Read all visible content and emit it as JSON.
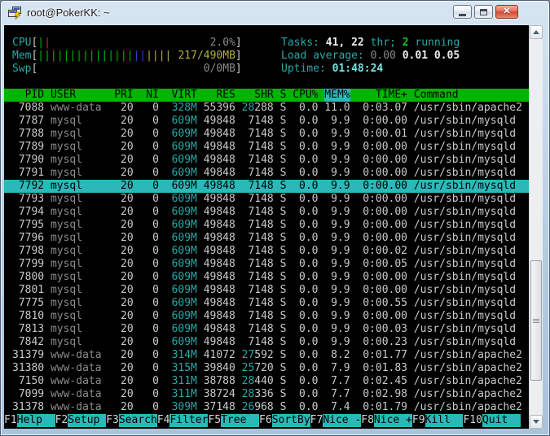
{
  "window": {
    "title": "root@PokerKK: ~"
  },
  "colors": {
    "header_green": "#00b400",
    "accent_cyan": "#2bb8b8",
    "teal_text": "#2aa8a8",
    "meter_green": "#00b400",
    "meter_red": "#c03030",
    "meter_blue": "#3a3ad0",
    "meter_yellow": "#b0b038",
    "terminal_bg": "#000000"
  },
  "meters": [
    {
      "name": "cpu",
      "label": "CPU",
      "value": "2.0%",
      "value_color": "#8a8a8a",
      "ticks": [
        {
          "color": "#00b400",
          "count": 1
        },
        {
          "color": "#c03030",
          "count": 1
        }
      ]
    },
    {
      "name": "mem",
      "label": "Mem",
      "value": "217/490MB",
      "value_color": "#b0b038",
      "ticks": [
        {
          "color": "#00b400",
          "count": 15
        },
        {
          "color": "#3a3ad0",
          "count": 2
        },
        {
          "color": "#b0b038",
          "count": 4
        }
      ]
    },
    {
      "name": "swp",
      "label": "Swp",
      "value": "0/0MB",
      "value_color": "#8a8a8a",
      "ticks": []
    }
  ],
  "stats": {
    "tasks": {
      "label": "Tasks: ",
      "count": "41, 22",
      "thr": " thr; ",
      "running_n": "2",
      "running": " running"
    },
    "load": {
      "label": "Load average: ",
      "v1": "0.00",
      "v2": " 0.01",
      "v3": " 0.05"
    },
    "uptime": {
      "label": "Uptime: ",
      "value": "01:48:24"
    }
  },
  "table": {
    "columns": {
      "pid": "PID",
      "user": "USER",
      "pri": "PRI",
      "ni": "NI",
      "virt": "VIRT",
      "res": "RES",
      "shr": "SHR",
      "s": "S",
      "cpu": "CPU%",
      "mem": "MEM%",
      "time": "TIME+",
      "cmd": "Command"
    },
    "sort_column": "MEM%",
    "rows": [
      {
        "pid": "7088",
        "user": "www-data",
        "pri": "20",
        "ni": "0",
        "virt": "328M",
        "res": "55396",
        "shr_hi": "28",
        "shr_lo": "288",
        "s": "S",
        "cpu": "0.0",
        "mem": "11.0",
        "time": "0:03.07",
        "cmd": "/usr/sbin/apache2",
        "selected": false
      },
      {
        "pid": "7787",
        "user": "mysql",
        "pri": "20",
        "ni": "0",
        "virt": "609M",
        "res": "49848",
        "shr_hi": "",
        "shr_lo": "7148",
        "s": "S",
        "cpu": "0.0",
        "mem": "9.9",
        "time": "0:00.00",
        "cmd": "/usr/sbin/mysqld",
        "selected": false
      },
      {
        "pid": "7788",
        "user": "mysql",
        "pri": "20",
        "ni": "0",
        "virt": "609M",
        "res": "49848",
        "shr_hi": "",
        "shr_lo": "7148",
        "s": "S",
        "cpu": "0.0",
        "mem": "9.9",
        "time": "0:00.01",
        "cmd": "/usr/sbin/mysqld",
        "selected": false
      },
      {
        "pid": "7789",
        "user": "mysql",
        "pri": "20",
        "ni": "0",
        "virt": "609M",
        "res": "49848",
        "shr_hi": "",
        "shr_lo": "7148",
        "s": "S",
        "cpu": "0.0",
        "mem": "9.9",
        "time": "0:00.00",
        "cmd": "/usr/sbin/mysqld",
        "selected": false
      },
      {
        "pid": "7790",
        "user": "mysql",
        "pri": "20",
        "ni": "0",
        "virt": "609M",
        "res": "49848",
        "shr_hi": "",
        "shr_lo": "7148",
        "s": "S",
        "cpu": "0.0",
        "mem": "9.9",
        "time": "0:00.00",
        "cmd": "/usr/sbin/mysqld",
        "selected": false
      },
      {
        "pid": "7791",
        "user": "mysql",
        "pri": "20",
        "ni": "0",
        "virt": "609M",
        "res": "49848",
        "shr_hi": "",
        "shr_lo": "7148",
        "s": "S",
        "cpu": "0.0",
        "mem": "9.9",
        "time": "0:00.00",
        "cmd": "/usr/sbin/mysqld",
        "selected": false
      },
      {
        "pid": "7792",
        "user": "mysql",
        "pri": "20",
        "ni": "0",
        "virt": "609M",
        "res": "49848",
        "shr_hi": "",
        "shr_lo": "7148",
        "s": "S",
        "cpu": "0.0",
        "mem": "9.9",
        "time": "0:00.00",
        "cmd": "/usr/sbin/mysqld",
        "selected": true
      },
      {
        "pid": "7793",
        "user": "mysql",
        "pri": "20",
        "ni": "0",
        "virt": "609M",
        "res": "49848",
        "shr_hi": "",
        "shr_lo": "7148",
        "s": "S",
        "cpu": "0.0",
        "mem": "9.9",
        "time": "0:00.00",
        "cmd": "/usr/sbin/mysqld",
        "selected": false
      },
      {
        "pid": "7794",
        "user": "mysql",
        "pri": "20",
        "ni": "0",
        "virt": "609M",
        "res": "49848",
        "shr_hi": "",
        "shr_lo": "7148",
        "s": "S",
        "cpu": "0.0",
        "mem": "9.9",
        "time": "0:00.00",
        "cmd": "/usr/sbin/mysqld",
        "selected": false
      },
      {
        "pid": "7795",
        "user": "mysql",
        "pri": "20",
        "ni": "0",
        "virt": "609M",
        "res": "49848",
        "shr_hi": "",
        "shr_lo": "7148",
        "s": "S",
        "cpu": "0.0",
        "mem": "9.9",
        "time": "0:00.00",
        "cmd": "/usr/sbin/mysqld",
        "selected": false
      },
      {
        "pid": "7796",
        "user": "mysql",
        "pri": "20",
        "ni": "0",
        "virt": "609M",
        "res": "49848",
        "shr_hi": "",
        "shr_lo": "7148",
        "s": "S",
        "cpu": "0.0",
        "mem": "9.9",
        "time": "0:00.00",
        "cmd": "/usr/sbin/mysqld",
        "selected": false
      },
      {
        "pid": "7798",
        "user": "mysql",
        "pri": "20",
        "ni": "0",
        "virt": "609M",
        "res": "49848",
        "shr_hi": "",
        "shr_lo": "7148",
        "s": "S",
        "cpu": "0.0",
        "mem": "9.9",
        "time": "0:00.02",
        "cmd": "/usr/sbin/mysqld",
        "selected": false
      },
      {
        "pid": "7799",
        "user": "mysql",
        "pri": "20",
        "ni": "0",
        "virt": "609M",
        "res": "49848",
        "shr_hi": "",
        "shr_lo": "7148",
        "s": "S",
        "cpu": "0.0",
        "mem": "9.9",
        "time": "0:00.05",
        "cmd": "/usr/sbin/mysqld",
        "selected": false
      },
      {
        "pid": "7800",
        "user": "mysql",
        "pri": "20",
        "ni": "0",
        "virt": "609M",
        "res": "49848",
        "shr_hi": "",
        "shr_lo": "7148",
        "s": "S",
        "cpu": "0.0",
        "mem": "9.9",
        "time": "0:00.00",
        "cmd": "/usr/sbin/mysqld",
        "selected": false
      },
      {
        "pid": "7801",
        "user": "mysql",
        "pri": "20",
        "ni": "0",
        "virt": "609M",
        "res": "49848",
        "shr_hi": "",
        "shr_lo": "7148",
        "s": "S",
        "cpu": "0.0",
        "mem": "9.9",
        "time": "0:00.00",
        "cmd": "/usr/sbin/mysqld",
        "selected": false
      },
      {
        "pid": "7775",
        "user": "mysql",
        "pri": "20",
        "ni": "0",
        "virt": "609M",
        "res": "49848",
        "shr_hi": "",
        "shr_lo": "7148",
        "s": "S",
        "cpu": "0.0",
        "mem": "9.9",
        "time": "0:00.55",
        "cmd": "/usr/sbin/mysqld",
        "selected": false
      },
      {
        "pid": "7810",
        "user": "mysql",
        "pri": "20",
        "ni": "0",
        "virt": "609M",
        "res": "49848",
        "shr_hi": "",
        "shr_lo": "7148",
        "s": "S",
        "cpu": "0.0",
        "mem": "9.9",
        "time": "0:00.00",
        "cmd": "/usr/sbin/mysqld",
        "selected": false
      },
      {
        "pid": "7813",
        "user": "mysql",
        "pri": "20",
        "ni": "0",
        "virt": "609M",
        "res": "49848",
        "shr_hi": "",
        "shr_lo": "7148",
        "s": "S",
        "cpu": "0.0",
        "mem": "9.9",
        "time": "0:00.03",
        "cmd": "/usr/sbin/mysqld",
        "selected": false
      },
      {
        "pid": "7842",
        "user": "mysql",
        "pri": "20",
        "ni": "0",
        "virt": "609M",
        "res": "49848",
        "shr_hi": "",
        "shr_lo": "7148",
        "s": "S",
        "cpu": "0.0",
        "mem": "9.9",
        "time": "0:00.23",
        "cmd": "/usr/sbin/mysqld",
        "selected": false
      },
      {
        "pid": "31379",
        "user": "www-data",
        "pri": "20",
        "ni": "0",
        "virt": "314M",
        "res": "41072",
        "shr_hi": "27",
        "shr_lo": "592",
        "s": "S",
        "cpu": "0.0",
        "mem": "8.2",
        "time": "0:01.77",
        "cmd": "/usr/sbin/apache2",
        "selected": false
      },
      {
        "pid": "31380",
        "user": "www-data",
        "pri": "20",
        "ni": "0",
        "virt": "315M",
        "res": "39840",
        "shr_hi": "25",
        "shr_lo": "720",
        "s": "S",
        "cpu": "0.0",
        "mem": "7.9",
        "time": "0:01.83",
        "cmd": "/usr/sbin/apache2",
        "selected": false
      },
      {
        "pid": "7150",
        "user": "www-data",
        "pri": "20",
        "ni": "0",
        "virt": "311M",
        "res": "38788",
        "shr_hi": "28",
        "shr_lo": "440",
        "s": "S",
        "cpu": "0.0",
        "mem": "7.7",
        "time": "0:02.45",
        "cmd": "/usr/sbin/apache2",
        "selected": false
      },
      {
        "pid": "7099",
        "user": "www-data",
        "pri": "20",
        "ni": "0",
        "virt": "311M",
        "res": "38724",
        "shr_hi": "28",
        "shr_lo": "336",
        "s": "S",
        "cpu": "0.0",
        "mem": "7.7",
        "time": "0:02.98",
        "cmd": "/usr/sbin/apache2",
        "selected": false
      },
      {
        "pid": "31378",
        "user": "www-data",
        "pri": "20",
        "ni": "0",
        "virt": "309M",
        "res": "37148",
        "shr_hi": "26",
        "shr_lo": "968",
        "s": "S",
        "cpu": "0.0",
        "mem": "7.4",
        "time": "0:01.79",
        "cmd": "/usr/sbin/apache2",
        "selected": false
      }
    ]
  },
  "fkeys": [
    {
      "key": "F1",
      "label": "Help"
    },
    {
      "key": "F2",
      "label": "Setup"
    },
    {
      "key": "F3",
      "label": "Search"
    },
    {
      "key": "F4",
      "label": "Filter"
    },
    {
      "key": "F5",
      "label": "Tree"
    },
    {
      "key": "F6",
      "label": "SortBy"
    },
    {
      "key": "F7",
      "label": "Nice -"
    },
    {
      "key": "F8",
      "label": "Nice +"
    },
    {
      "key": "F9",
      "label": "Kill"
    },
    {
      "key": "F10",
      "label": "Quit"
    }
  ]
}
